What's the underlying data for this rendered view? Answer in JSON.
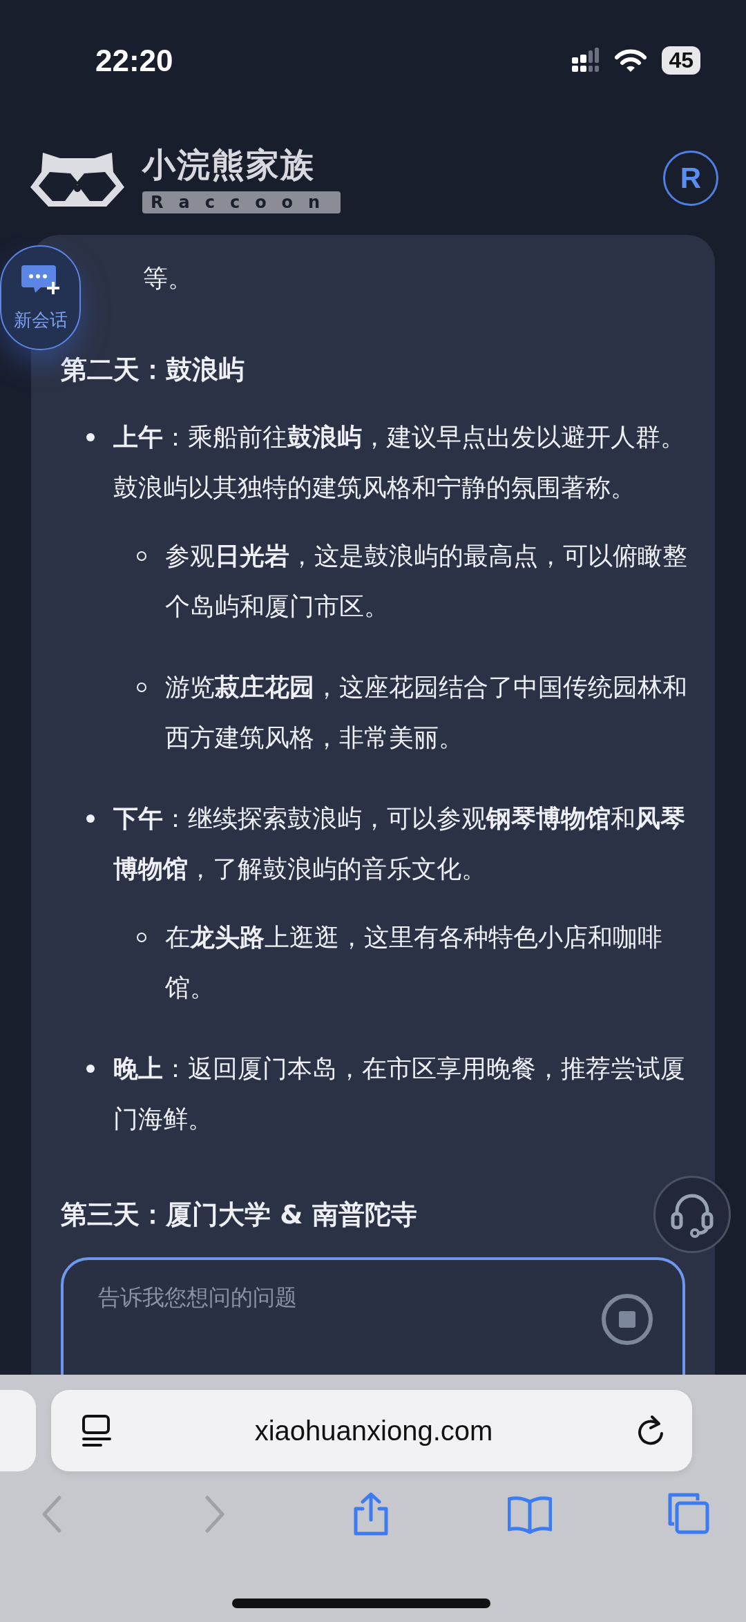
{
  "status_bar": {
    "time": "22:20",
    "battery": "45"
  },
  "header": {
    "logo_title": "小浣熊家族",
    "logo_subtitle": "Raccoon",
    "avatar": "R"
  },
  "new_chat_button": {
    "label": "新会话"
  },
  "content": [
    {
      "kind": "continuation",
      "text": "等。"
    },
    {
      "kind": "heading",
      "text": "第二天：鼓浪屿"
    },
    {
      "kind": "bullet",
      "text": "**上午**：乘船前往**鼓浪屿**，建议早点出发以避开人群。鼓浪屿以其独特的建筑风格和宁静的氛围著称。",
      "children": [
        {
          "text": "参观**日光岩**，这是鼓浪屿的最高点，可以俯瞰整个岛屿和厦门市区。"
        },
        {
          "text": "游览**菽庄花园**，这座花园结合了中国传统园林和西方建筑风格，非常美丽。"
        }
      ]
    },
    {
      "kind": "bullet",
      "text": "**下午**：继续探索鼓浪屿，可以参观**钢琴博物馆**和**风琴博物馆**，了解鼓浪屿的音乐文化。",
      "children": [
        {
          "text": "在**龙头路**上逛逛，这里有各种特色小店和咖啡馆。"
        }
      ]
    },
    {
      "kind": "bullet",
      "text": "**晚上**：返回厦门本岛，在市区享用晚餐，推荐尝试厦门海鲜。"
    },
    {
      "kind": "heading",
      "text": "第三天：厦门大学 & 南普陀寺"
    }
  ],
  "input": {
    "placeholder": "告诉我您想问的问题"
  },
  "browser": {
    "url": "xiaohuanxiong.com",
    "toolbar": [
      {
        "kind": "back",
        "disabled": true
      },
      {
        "kind": "forward",
        "disabled": true
      },
      {
        "kind": "share",
        "disabled": false
      },
      {
        "kind": "bookmarks",
        "disabled": false
      },
      {
        "kind": "tabs",
        "disabled": false
      }
    ]
  }
}
